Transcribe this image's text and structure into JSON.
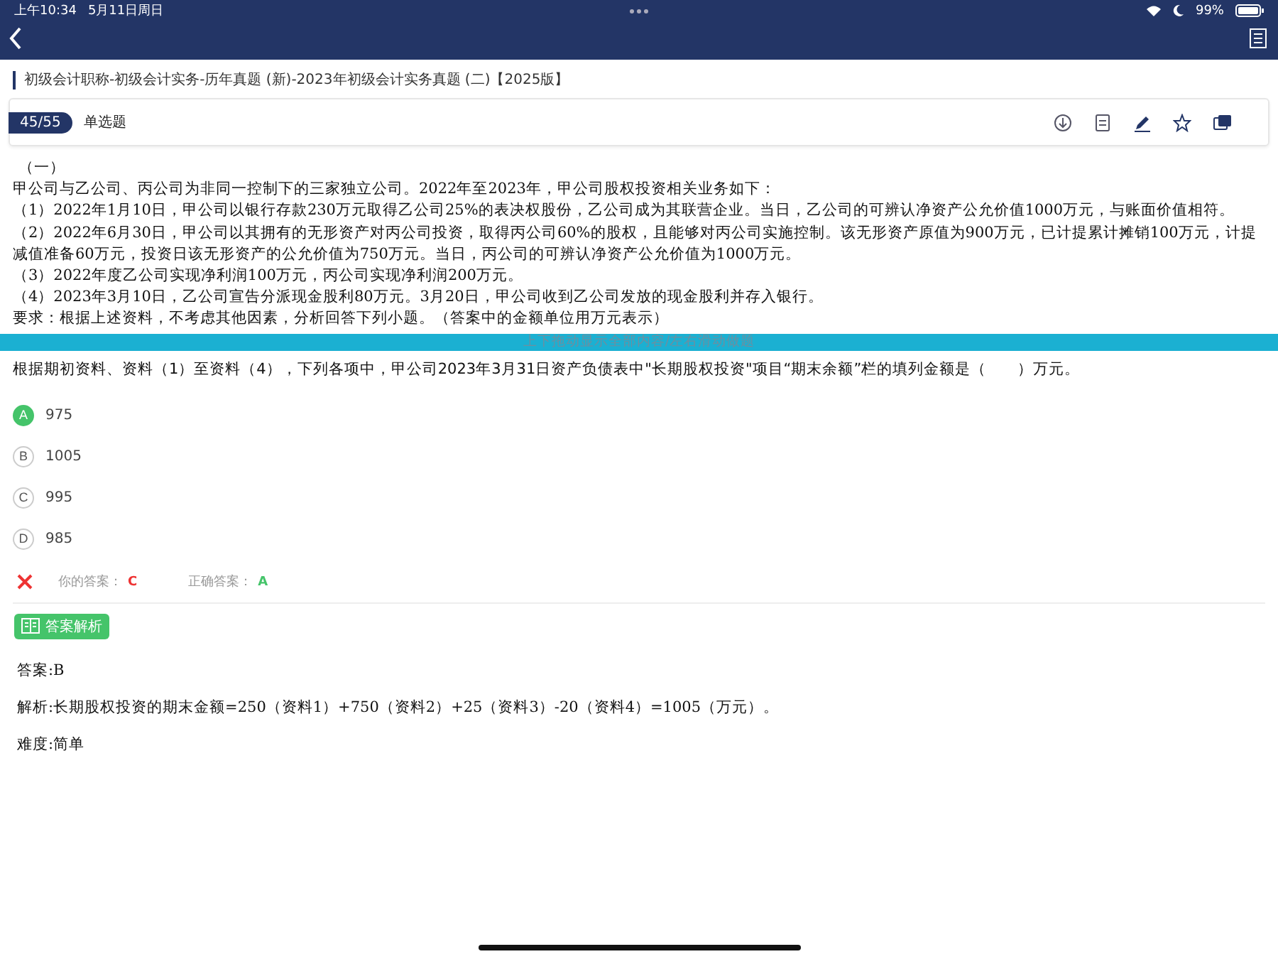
{
  "status_bar": {
    "time": "上午10:34",
    "date": "5月11日周日",
    "battery": "99%"
  },
  "breadcrumb": "初级会计职称-初级会计实务-历年真题 (新)-2023年初级会计实务真题 (二)【2025版】",
  "header": {
    "progress": "45/55",
    "question_type": "单选题"
  },
  "passage": {
    "heading": "（一）",
    "paragraphs": [
      "甲公司与乙公司、丙公司为非同一控制下的三家独立公司。2022年至2023年，甲公司股权投资相关业务如下：",
      "（1）2022年1月10日，甲公司以银行存款230万元取得乙公司25%的表决权股份，乙公司成为其联营企业。当日，乙公司的可辨认净资产公允价值1000万元，与账面价值相符。",
      "（2）2022年6月30日，甲公司以其拥有的无形资产对丙公司投资，取得丙公司60%的股权，且能够对丙公司实施控制。该无形资产原值为900万元，已计提累计摊销100万元，计提减值准备60万元，投资日该无形资产的公允价值为750万元。当日，丙公司的可辨认净资产公允价值为1000万元。",
      "（3）2022年度乙公司实现净利润100万元，丙公司实现净利润200万元。",
      "（4）2023年3月10日，乙公司宣告分派现金股利80万元。3月20日，甲公司收到乙公司发放的现金股利并存入银行。",
      "要求：根据上述资料，不考虑其他因素，分析回答下列小题。（答案中的金额单位用万元表示）"
    ]
  },
  "drag_hint": "上下拖动显示全部内容/左右滑动做题",
  "question": "根据期初资料、资料（1）至资料（4），下列各项中，甲公司2023年3月31日资产负债表中\"长期股权投资\"项目“期末余额”栏的填列金额是（　　）万元。",
  "options": [
    {
      "letter": "A",
      "text": "975",
      "selected": true
    },
    {
      "letter": "B",
      "text": "1005",
      "selected": false
    },
    {
      "letter": "C",
      "text": "995",
      "selected": false
    },
    {
      "letter": "D",
      "text": "985",
      "selected": false
    }
  ],
  "result": {
    "correct": false,
    "your_answer_label": "你的答案：",
    "your_answer": "C",
    "correct_answer_label": "正确答案：",
    "correct_answer": "A"
  },
  "analysis": {
    "button": "答案解析",
    "answer": "答案:B",
    "explanation": "解析:长期股权投资的期末金额=250（资料1）+750（资料2）+25（资料3）-20（资料4）=1005（万元）。",
    "difficulty": "难度:简单"
  }
}
